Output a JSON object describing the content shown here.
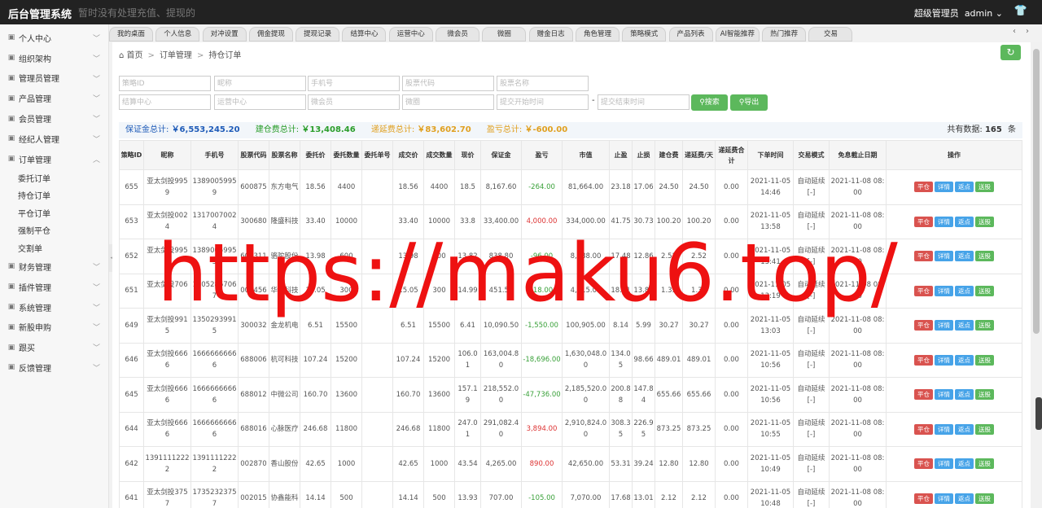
{
  "app": {
    "title": "后台管理系统",
    "notice": "暂时没有处理充值、提现的"
  },
  "user": {
    "role": "超级管理员",
    "name": "admin"
  },
  "sidebar": {
    "items": [
      {
        "label": "个人中心",
        "icon": "user-icon"
      },
      {
        "label": "组织架构",
        "icon": "org-icon"
      },
      {
        "label": "管理员管理",
        "icon": "admin-icon"
      },
      {
        "label": "产品管理",
        "icon": "product-icon"
      },
      {
        "label": "会员管理",
        "icon": "member-icon"
      },
      {
        "label": "经纪人管理",
        "icon": "agent-icon"
      },
      {
        "label": "订单管理",
        "icon": "order-icon"
      }
    ],
    "subitems": [
      "委托订单",
      "持仓订单",
      "平仓订单",
      "强制平仓",
      "交割单"
    ],
    "items2": [
      {
        "label": "财务管理",
        "icon": "finance-icon"
      },
      {
        "label": "插件管理",
        "icon": "plugin-icon"
      },
      {
        "label": "系统管理",
        "icon": "system-icon"
      },
      {
        "label": "新股申购",
        "icon": "ipo-icon"
      },
      {
        "label": "跟买",
        "icon": "follow-icon"
      },
      {
        "label": "反馈管理",
        "icon": "feedback-icon"
      }
    ]
  },
  "tabs": [
    "我的桌面",
    "个人信息",
    "对冲设置",
    "佣金提现",
    "提现记录",
    "结算中心",
    "运营中心",
    "微会员",
    "微圈",
    "赠金日志",
    "角色管理",
    "策略模式",
    "产品列表",
    "AI智能推荐",
    "热门推荐",
    "交易"
  ],
  "breadcrumb": {
    "home": "首页",
    "level1": "订单管理",
    "level2": "持仓订单"
  },
  "search": {
    "row1": [
      "策略ID",
      "昵称",
      "手机号",
      "股票代码",
      "股票名称"
    ],
    "row2": [
      "结算中心",
      "运营中心",
      "微会员",
      "微圈",
      "提交开始时间"
    ],
    "end_time": "提交结束时间",
    "dash": "-",
    "search_btn": "搜索",
    "export_btn": "导出"
  },
  "summary": {
    "margin_label": "保证金总计:",
    "margin_value": "￥6,553,245.20",
    "open_fee_label": "建仓费总计:",
    "open_fee_value": "￥13,408.46",
    "deferred_label": "递延费总计:",
    "deferred_value": "￥83,602.70",
    "pnl_label": "盈亏总计:",
    "pnl_value": "￥-600.00",
    "count_label": "共有数据:",
    "count_value": "165",
    "count_unit": "条"
  },
  "colors": {
    "margin": "#1e5bb8",
    "open_fee": "#2a9d2a",
    "deferred": "#e0a020",
    "pnl": "#e0a020",
    "green_btn": "#5cb85c",
    "red_btn": "#d9534f",
    "blue_btn": "#46a3e8"
  },
  "table": {
    "headers": [
      "策略ID",
      "昵称",
      "手机号",
      "股票代码",
      "股票名称",
      "委托价",
      "委托数量",
      "委托单号",
      "成交价",
      "成交数量",
      "现价",
      "保证金",
      "盈亏",
      "市值",
      "止盈",
      "止损",
      "建仓费",
      "递延费/天",
      "递延费合计",
      "下单时间",
      "交易模式",
      "免息截止日期",
      "操作"
    ],
    "actions": [
      "平仓",
      "详情",
      "返点",
      "送股"
    ],
    "rows": [
      [
        "655",
        "亚太剑投9959",
        "13890059959",
        "600875",
        "东方电气",
        "18.56",
        "4400",
        "",
        "18.56",
        "4400",
        "18.5",
        "8,167.60",
        "-264.00",
        "81,664.00",
        "23.18",
        "17.06",
        "24.50",
        "24.50",
        "0.00",
        "2021-11-05 14:46",
        "自动延续[-]",
        "2021-11-08 08:00"
      ],
      [
        "653",
        "亚太剑投0024",
        "13170070024",
        "300680",
        "隆盛科技",
        "33.40",
        "10000",
        "",
        "33.40",
        "10000",
        "33.8",
        "33,400.00",
        "4,000.00",
        "334,000.00",
        "41.75",
        "30.73",
        "100.20",
        "100.20",
        "0.00",
        "2021-11-05 13:58",
        "自动延续[-]",
        "2021-11-08 08:00"
      ],
      [
        "652",
        "亚太剑投9955",
        "13890059955",
        "601311",
        "骆驼股份",
        "13.98",
        "600",
        "",
        "13.98",
        "600",
        "13.82",
        "838.80",
        "-96.00",
        "8,388.00",
        "17.48",
        "12.86",
        "2.52",
        "2.52",
        "0.00",
        "2021-11-05 13:41",
        "自动延续[-]",
        "2021-11-08 08:00"
      ],
      [
        "651",
        "亚太剑投7067",
        "13052867067",
        "002456",
        "华软科技",
        "15.05",
        "300",
        "",
        "15.05",
        "300",
        "14.99",
        "451.50",
        "-18.00",
        "4,515.00",
        "18.81",
        "13.85",
        "1.35",
        "1.35",
        "0.00",
        "2021-11-05 13:19",
        "自动延续[-]",
        "2021-11-08 08:00"
      ],
      [
        "649",
        "亚太剑投9915",
        "13502939915",
        "300032",
        "金龙机电",
        "6.51",
        "15500",
        "",
        "6.51",
        "15500",
        "6.41",
        "10,090.50",
        "-1,550.00",
        "100,905.00",
        "8.14",
        "5.99",
        "30.27",
        "30.27",
        "0.00",
        "2021-11-05 13:03",
        "自动延续[-]",
        "2021-11-08 08:00"
      ],
      [
        "646",
        "亚太剑投6666",
        "16666666666",
        "688006",
        "杭可科技",
        "107.24",
        "15200",
        "",
        "107.24",
        "15200",
        "106.01",
        "163,004.80",
        "-18,696.00",
        "1,630,048.00",
        "134.05",
        "98.66",
        "489.01",
        "489.01",
        "0.00",
        "2021-11-05 10:56",
        "自动延续[-]",
        "2021-11-08 08:00"
      ],
      [
        "645",
        "亚太剑投6666",
        "16666666666",
        "688012",
        "中微公司",
        "160.70",
        "13600",
        "",
        "160.70",
        "13600",
        "157.19",
        "218,552.00",
        "-47,736.00",
        "2,185,520.00",
        "200.88",
        "147.84",
        "655.66",
        "655.66",
        "0.00",
        "2021-11-05 10:56",
        "自动延续[-]",
        "2021-11-08 08:00"
      ],
      [
        "644",
        "亚太剑投6666",
        "16666666666",
        "688016",
        "心脉医疗",
        "246.68",
        "11800",
        "",
        "246.68",
        "11800",
        "247.01",
        "291,082.40",
        "3,894.00",
        "2,910,824.00",
        "308.35",
        "226.95",
        "873.25",
        "873.25",
        "0.00",
        "2021-11-05 10:55",
        "自动延续[-]",
        "2021-11-08 08:00"
      ],
      [
        "642",
        "13911112222",
        "13911112222",
        "002870",
        "香山股份",
        "42.65",
        "1000",
        "",
        "42.65",
        "1000",
        "43.54",
        "4,265.00",
        "890.00",
        "42,650.00",
        "53.31",
        "39.24",
        "12.80",
        "12.80",
        "0.00",
        "2021-11-05 10:49",
        "自动延续[-]",
        "2021-11-08 08:00"
      ],
      [
        "641",
        "亚太剑投3757",
        "17352323757",
        "002015",
        "协鑫能科",
        "14.14",
        "500",
        "",
        "14.14",
        "500",
        "13.93",
        "707.00",
        "-105.00",
        "7,070.00",
        "17.68",
        "13.01",
        "2.12",
        "2.12",
        "0.00",
        "2021-11-05 10:48",
        "自动延续[-]",
        "2021-11-08 08:00"
      ]
    ]
  },
  "watermark": "https://maku6.top/"
}
